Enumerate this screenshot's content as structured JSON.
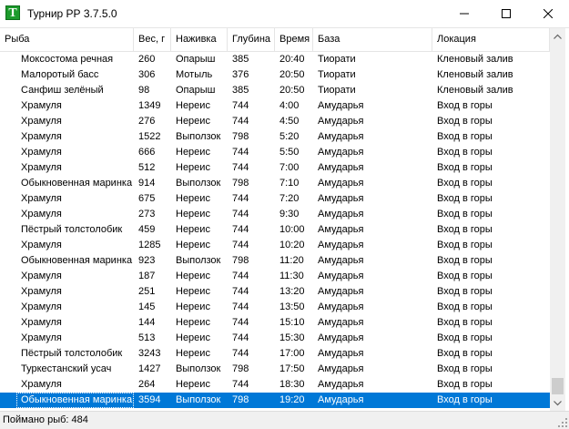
{
  "window": {
    "title": "Турнир РР 3.7.5.0",
    "icon_letter": "T"
  },
  "table": {
    "columns": [
      "Рыба",
      "Вес, г",
      "Наживка",
      "Глубина",
      "Время",
      "База",
      "Локация"
    ],
    "rows": [
      [
        "Моксостома речная",
        "260",
        "Опарыш",
        "385",
        "20:40",
        "Тиорати",
        "Кленовый залив"
      ],
      [
        "Малоротый басс",
        "306",
        "Мотыль",
        "376",
        "20:50",
        "Тиорати",
        "Кленовый залив"
      ],
      [
        "Санфиш зелёный",
        "98",
        "Опарыш",
        "385",
        "20:50",
        "Тиорати",
        "Кленовый залив"
      ],
      [
        "Храмуля",
        "1349",
        "Нереис",
        "744",
        "4:00",
        "Амударья",
        "Вход в горы"
      ],
      [
        "Храмуля",
        "276",
        "Нереис",
        "744",
        "4:50",
        "Амударья",
        "Вход в горы"
      ],
      [
        "Храмуля",
        "1522",
        "Выползок",
        "798",
        "5:20",
        "Амударья",
        "Вход в горы"
      ],
      [
        "Храмуля",
        "666",
        "Нереис",
        "744",
        "5:50",
        "Амударья",
        "Вход в горы"
      ],
      [
        "Храмуля",
        "512",
        "Нереис",
        "744",
        "7:00",
        "Амударья",
        "Вход в горы"
      ],
      [
        "Обыкновенная маринка",
        "914",
        "Выползок",
        "798",
        "7:10",
        "Амударья",
        "Вход в горы"
      ],
      [
        "Храмуля",
        "675",
        "Нереис",
        "744",
        "7:20",
        "Амударья",
        "Вход в горы"
      ],
      [
        "Храмуля",
        "273",
        "Нереис",
        "744",
        "9:30",
        "Амударья",
        "Вход в горы"
      ],
      [
        "Пёстрый толстолобик",
        "459",
        "Нереис",
        "744",
        "10:00",
        "Амударья",
        "Вход в горы"
      ],
      [
        "Храмуля",
        "1285",
        "Нереис",
        "744",
        "10:20",
        "Амударья",
        "Вход в горы"
      ],
      [
        "Обыкновенная маринка",
        "923",
        "Выползок",
        "798",
        "11:20",
        "Амударья",
        "Вход в горы"
      ],
      [
        "Храмуля",
        "187",
        "Нереис",
        "744",
        "11:30",
        "Амударья",
        "Вход в горы"
      ],
      [
        "Храмуля",
        "251",
        "Нереис",
        "744",
        "13:20",
        "Амударья",
        "Вход в горы"
      ],
      [
        "Храмуля",
        "145",
        "Нереис",
        "744",
        "13:50",
        "Амударья",
        "Вход в горы"
      ],
      [
        "Храмуля",
        "144",
        "Нереис",
        "744",
        "15:10",
        "Амударья",
        "Вход в горы"
      ],
      [
        "Храмуля",
        "513",
        "Нереис",
        "744",
        "15:30",
        "Амударья",
        "Вход в горы"
      ],
      [
        "Пёстрый толстолобик",
        "3243",
        "Нереис",
        "744",
        "17:00",
        "Амударья",
        "Вход в горы"
      ],
      [
        "Туркестанский усач",
        "1427",
        "Выползок",
        "798",
        "17:50",
        "Амударья",
        "Вход в горы"
      ],
      [
        "Храмуля",
        "264",
        "Нереис",
        "744",
        "18:30",
        "Амударья",
        "Вход в горы"
      ],
      [
        "Обыкновенная маринка",
        "3594",
        "Выползок",
        "798",
        "19:20",
        "Амударья",
        "Вход в горы"
      ]
    ],
    "selected_row": 22
  },
  "status": {
    "text": "Поймано рыб: 484"
  },
  "colors": {
    "selection": "#0078d7",
    "app_icon": "#1c9b2c"
  }
}
